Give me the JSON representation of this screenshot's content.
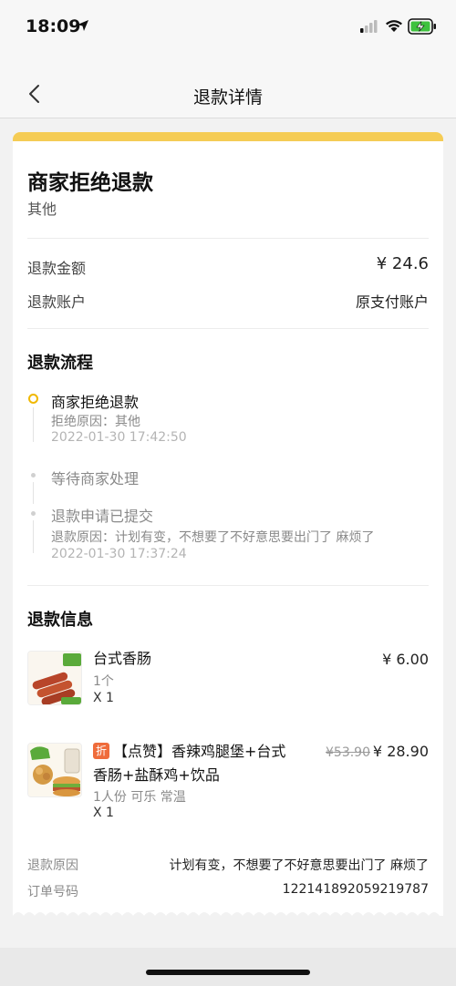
{
  "status_bar": {
    "time": "18:09",
    "icons": [
      "location-arrow-icon",
      "signal-icon",
      "wifi-icon",
      "battery-charging-icon"
    ]
  },
  "nav": {
    "title": "退款详情",
    "back_icon": "chevron-left-icon"
  },
  "colors": {
    "accent": "#f5cc55",
    "timeline_active": "#f0b800",
    "discount_badge": "#ef6c3b"
  },
  "status": {
    "title": "商家拒绝退款",
    "subtitle": "其他"
  },
  "refund": {
    "amount_label": "退款金额",
    "amount_value": "¥ 24.6",
    "account_label": "退款账户",
    "account_value": "原支付账户"
  },
  "flow": {
    "title": "退款流程",
    "steps": [
      {
        "title": "商家拒绝退款",
        "detail": "拒绝原因：其他",
        "time": "2022-01-30 17:42:50"
      },
      {
        "title": "等待商家处理"
      },
      {
        "title": "退款申请已提交",
        "detail": "退款原因：计划有变，不想要了不好意思要出门了 麻烦了",
        "time": "2022-01-30 17:37:24"
      }
    ]
  },
  "info": {
    "title": "退款信息",
    "items": [
      {
        "name": "台式香肠",
        "price": "¥ 6.00",
        "spec": "1个",
        "qty": "X 1"
      },
      {
        "badge": "折",
        "name_line1": "【点赞】香辣鸡腿堡+台式",
        "name_line2": "香肠+盐酥鸡+饮品",
        "orig_price": "¥53.90",
        "price": "¥ 28.90",
        "spec": "1人份 可乐 常温",
        "qty": "X 1"
      }
    ],
    "reason_label": "退款原因",
    "reason_value": "计划有变，不想要了不好意思要出门了 麻烦了",
    "order_label": "订单号码",
    "order_value": "1221418920592197​87"
  }
}
